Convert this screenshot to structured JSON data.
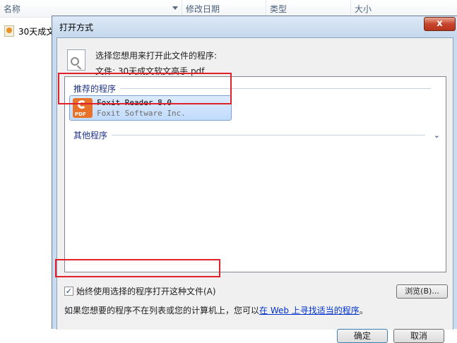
{
  "explorer": {
    "columns": [
      "名称",
      "修改日期",
      "类型",
      "大小"
    ],
    "file_name": "30天成文"
  },
  "dialog": {
    "title": "打开方式",
    "close_glyph": "x",
    "prompt": "选择您想用来打开此文件的程序:",
    "file_label": "文件:  30天成文软文高手.pdf",
    "recommended_header": "推荐的程序",
    "other_header": "其他程序",
    "program": {
      "name": "Foxit Reader 8.0",
      "vendor": "Foxit Software Inc."
    },
    "always_use_label": "始终使用选择的程序打开这种文件(A)",
    "always_use_checked": true,
    "browse_label": "浏览(B)...",
    "info_text": "如果您想要的程序不在列表或您的计算机上，您可以",
    "info_link": "在 Web 上寻找适当的程序",
    "info_suffix": "。",
    "ok_label": "确定",
    "cancel_label": "取消"
  },
  "colors": {
    "highlight": "#e0202a",
    "group_header": "#1e3287",
    "foxit_orange": "#e8722a"
  }
}
